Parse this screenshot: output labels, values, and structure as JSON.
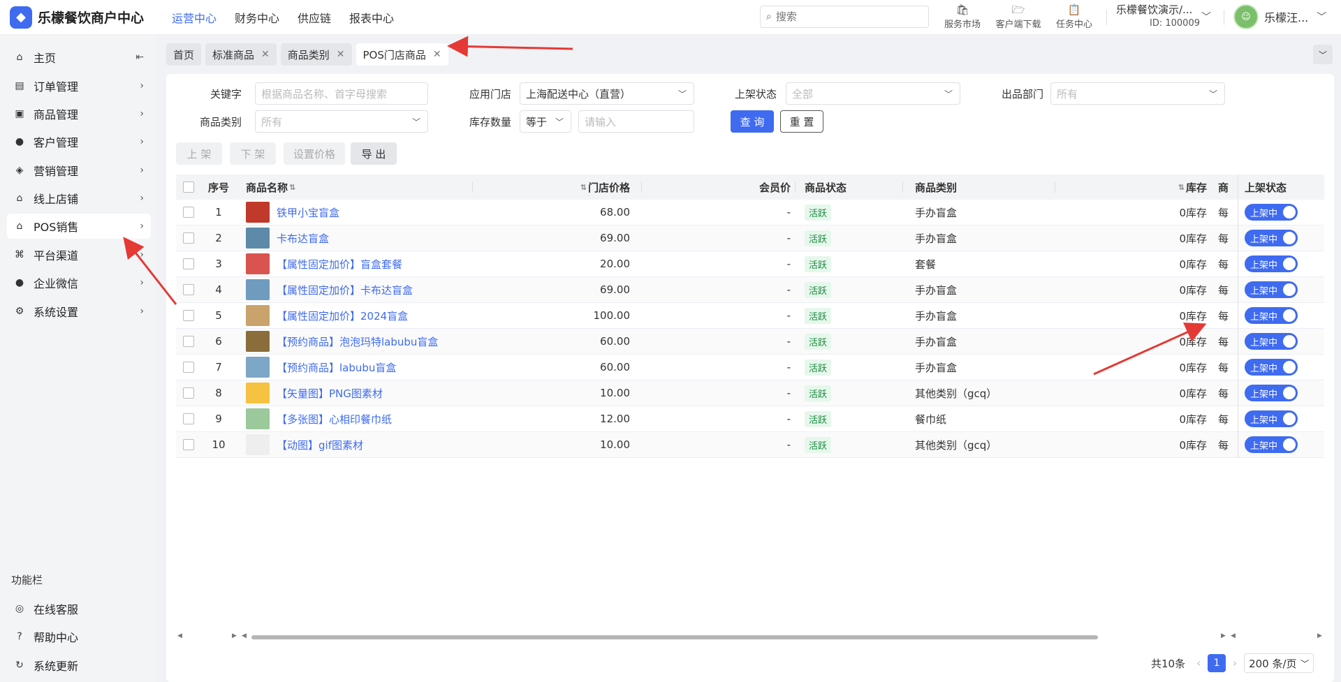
{
  "header": {
    "logo_text": "乐檬餐饮商户中心",
    "nav": [
      "运营中心",
      "财务中心",
      "供应链",
      "报表中心"
    ],
    "search_placeholder": "搜索",
    "tools": [
      {
        "label": "服务市场",
        "icon": "store-icon"
      },
      {
        "label": "客户端下载",
        "icon": "download-folder-icon"
      },
      {
        "label": "任务中心",
        "icon": "clipboard-icon"
      }
    ],
    "org_name": "乐檬餐饮演示/...",
    "org_id": "ID: 100009",
    "user_name": "乐檬汪..."
  },
  "sidebar": {
    "items": [
      {
        "label": "主页",
        "icon": "home-icon"
      },
      {
        "label": "订单管理",
        "icon": "order-icon"
      },
      {
        "label": "商品管理",
        "icon": "goods-icon"
      },
      {
        "label": "客户管理",
        "icon": "user-icon"
      },
      {
        "label": "营销管理",
        "icon": "tag-icon"
      },
      {
        "label": "线上店铺",
        "icon": "shop-icon"
      },
      {
        "label": "POS销售",
        "icon": "pos-icon"
      },
      {
        "label": "平台渠道",
        "icon": "bank-icon"
      },
      {
        "label": "企业微信",
        "icon": "wechat-icon"
      },
      {
        "label": "系统设置",
        "icon": "gear-icon"
      }
    ],
    "section_title": "功能栏",
    "bottom_items": [
      {
        "label": "在线客服",
        "icon": "headset-icon"
      },
      {
        "label": "帮助中心",
        "icon": "help-icon"
      },
      {
        "label": "系统更新",
        "icon": "refresh-icon"
      }
    ]
  },
  "tabs": [
    {
      "label": "首页",
      "closable": false
    },
    {
      "label": "标准商品",
      "closable": true
    },
    {
      "label": "商品类别",
      "closable": true
    },
    {
      "label": "POS门店商品",
      "closable": true
    }
  ],
  "filters": {
    "keyword_label": "关键字",
    "keyword_placeholder": "根据商品名称、首字母搜索",
    "store_label": "应用门店",
    "store_value": "上海配送中心（直营）",
    "status_label": "上架状态",
    "status_placeholder": "全部",
    "dept_label": "出品部门",
    "dept_placeholder": "所有",
    "category_label": "商品类别",
    "category_placeholder": "所有",
    "stock_label": "库存数量",
    "stock_op": "等于",
    "stock_placeholder": "请输入",
    "query_btn": "查 询",
    "reset_btn": "重 置"
  },
  "actions": {
    "on_shelf": "上 架",
    "off_shelf": "下 架",
    "set_price": "设置价格",
    "export": "导 出"
  },
  "table": {
    "headers": {
      "index": "序号",
      "name": "商品名称",
      "price": "门店价格",
      "member_price": "会员价",
      "status": "商品状态",
      "category": "商品类别",
      "stock": "库存",
      "extra": "商",
      "shelf": "上架状态"
    },
    "rows": [
      {
        "index": "1",
        "name": "铁甲小宝盲盒",
        "price": "68.00",
        "member": "-",
        "status": "活跃",
        "category": "手办盲盒",
        "stock": "0库存",
        "extra": "每",
        "shelf": "上架中",
        "thumb": "#c0392b"
      },
      {
        "index": "2",
        "name": "卡布达盲盒",
        "price": "69.00",
        "member": "-",
        "status": "活跃",
        "category": "手办盲盒",
        "stock": "0库存",
        "extra": "每",
        "shelf": "上架中",
        "thumb": "#5d8aa8"
      },
      {
        "index": "3",
        "name": "【属性固定加价】盲盒套餐",
        "price": "20.00",
        "member": "-",
        "status": "活跃",
        "category": "套餐",
        "stock": "0库存",
        "extra": "每",
        "shelf": "上架中",
        "thumb": "#d9534f"
      },
      {
        "index": "4",
        "name": "【属性固定加价】卡布达盲盒",
        "price": "69.00",
        "member": "-",
        "status": "活跃",
        "category": "手办盲盒",
        "stock": "0库存",
        "extra": "每",
        "shelf": "上架中",
        "thumb": "#6f9bbf"
      },
      {
        "index": "5",
        "name": "【属性固定加价】2024盲盒",
        "price": "100.00",
        "member": "-",
        "status": "活跃",
        "category": "手办盲盒",
        "stock": "0库存",
        "extra": "每",
        "shelf": "上架中",
        "thumb": "#c9a36b"
      },
      {
        "index": "6",
        "name": "【预约商品】泡泡玛特labubu盲盒",
        "price": "60.00",
        "member": "-",
        "status": "活跃",
        "category": "手办盲盒",
        "stock": "0库存",
        "extra": "每",
        "shelf": "上架中",
        "thumb": "#8a6d3b"
      },
      {
        "index": "7",
        "name": "【预约商品】labubu盲盒",
        "price": "60.00",
        "member": "-",
        "status": "活跃",
        "category": "手办盲盒",
        "stock": "0库存",
        "extra": "每",
        "shelf": "上架中",
        "thumb": "#7da7c6"
      },
      {
        "index": "8",
        "name": "【矢量图】PNG图素材",
        "price": "10.00",
        "member": "-",
        "status": "活跃",
        "category": "其他类别（gcq）",
        "stock": "0库存",
        "extra": "每",
        "shelf": "上架中",
        "thumb": "#f5c242"
      },
      {
        "index": "9",
        "name": "【多张图】心相印餐巾纸",
        "price": "12.00",
        "member": "-",
        "status": "活跃",
        "category": "餐巾纸",
        "stock": "0库存",
        "extra": "每",
        "shelf": "上架中",
        "thumb": "#9bc99b"
      },
      {
        "index": "10",
        "name": "【动图】gif图素材",
        "price": "10.00",
        "member": "-",
        "status": "活跃",
        "category": "其他类别（gcq）",
        "stock": "0库存",
        "extra": "每",
        "shelf": "上架中",
        "thumb": "#eeeeee"
      }
    ]
  },
  "pager": {
    "total": "共10条",
    "current": "1",
    "page_size": "200 条/页"
  },
  "colors": {
    "accent": "#3f6bf0",
    "annotation_arrow": "#e53935",
    "status_bg": "#e6f7ec",
    "status_text": "#1a8a3e"
  }
}
